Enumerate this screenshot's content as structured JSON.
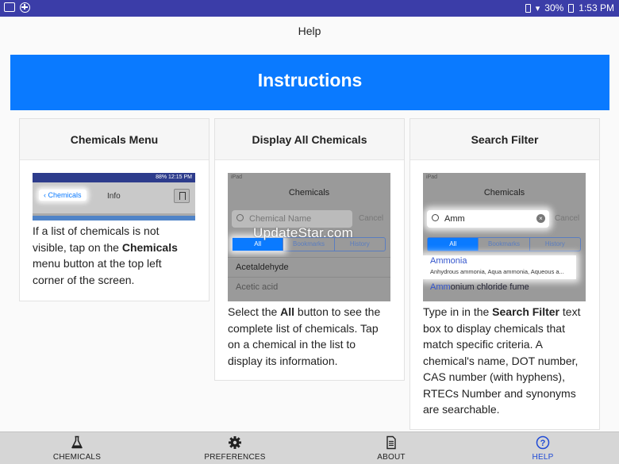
{
  "status_bar": {
    "battery": "30%",
    "time": "1:53 PM"
  },
  "header": {
    "title": "Help"
  },
  "banner": {
    "title": "Instructions"
  },
  "cards": [
    {
      "title": "Chemicals Menu",
      "thumb": {
        "back_label": "Chemicals",
        "screen_title": "Info",
        "status": "88% 12:15 PM"
      },
      "desc_1": "If a list of chemicals is not visible, tap on the ",
      "desc_bold": "Chemicals",
      "desc_2": " menu button at the top left corner of the screen."
    },
    {
      "title": "Display All Chemicals",
      "thumb": {
        "device": "iPad",
        "screen_title": "Chemicals",
        "search_placeholder": "Chemical Name",
        "cancel": "Cancel",
        "segments": [
          "All",
          "Bookmarks",
          "History"
        ],
        "rows": [
          "Acetaldehyde",
          "Acetic acid"
        ],
        "watermark": "UpdateStar.com"
      },
      "desc_1": "Select the ",
      "desc_bold": "All",
      "desc_2": " button to see the complete list of chemicals. Tap on a chemical in the list to display its information."
    },
    {
      "title": "Search Filter",
      "thumb": {
        "device": "iPad",
        "screen_title": "Chemicals",
        "search_value": "Amm",
        "cancel": "Cancel",
        "segments": [
          "All",
          "Bookmarks",
          "History"
        ],
        "result_name": "Ammonia",
        "result_synonyms": "Anhydrous ammonia, Aqua ammonia, Aqueous a...",
        "result2_hl": "Amm",
        "result2_rest": "onium chloride fume"
      },
      "desc_1": "Type in in the ",
      "desc_bold": "Search Filter",
      "desc_2": " text box to display chemicals that match specific criteria. A chemical's name, DOT number, CAS number (with hyphens), RTECs Number and synonyms are searchable."
    }
  ],
  "tabs": [
    {
      "label": "CHEMICALS",
      "icon": "flask-icon",
      "active": false
    },
    {
      "label": "PREFERENCES",
      "icon": "gear-icon",
      "active": false
    },
    {
      "label": "ABOUT",
      "icon": "document-icon",
      "active": false
    },
    {
      "label": "HELP",
      "icon": "question-circle-icon",
      "active": true
    }
  ],
  "colors": {
    "status_bar": "#3b3da8",
    "banner": "#0a7aff",
    "active_tab": "#1f4ad6",
    "tab_bar": "#d6d6d6"
  }
}
